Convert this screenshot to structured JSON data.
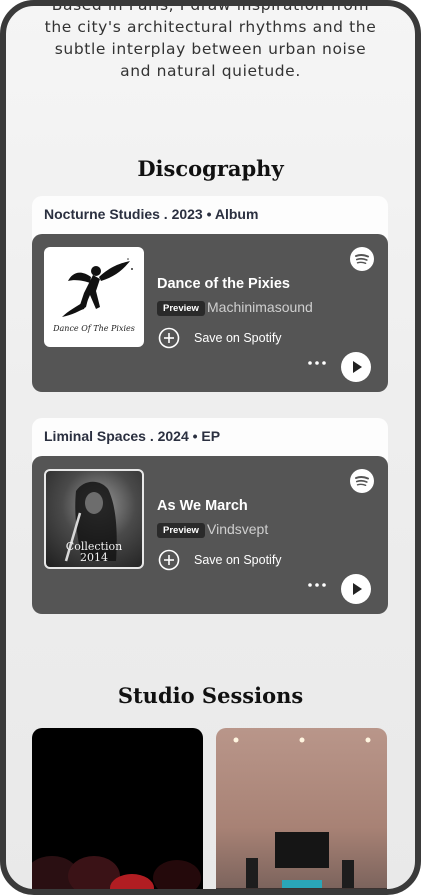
{
  "bio": {
    "line1": "Based in Paris, I draw inspiration from",
    "line2": "the city's architectural rhythms and the",
    "line3": "subtle interplay between urban noise",
    "line4": "and natural quietude."
  },
  "discography": {
    "title": "Discography",
    "releases": [
      {
        "header": "Nocturne Studies . 2023 • Album",
        "track": "Dance of the Pixies",
        "badge": "Preview",
        "artist": "Machinimasound",
        "save_label": "Save on Spotify",
        "cover_text": "Dance Of The Pixies",
        "cover_icon": "fairy-silhouette"
      },
      {
        "header": "Liminal Spaces . 2024 • EP",
        "track": "As We March",
        "badge": "Preview",
        "artist": "Vindsvept",
        "save_label": "Save on Spotify",
        "cover_text_line1": "Collection",
        "cover_text_line2": "2014",
        "cover_icon": "flute-player-photo"
      }
    ]
  },
  "studio": {
    "title": "Studio Sessions"
  },
  "colors": {
    "player_bg": "#555555",
    "header_bg": "#fdfdfd",
    "frame": "#3a3a3a"
  }
}
